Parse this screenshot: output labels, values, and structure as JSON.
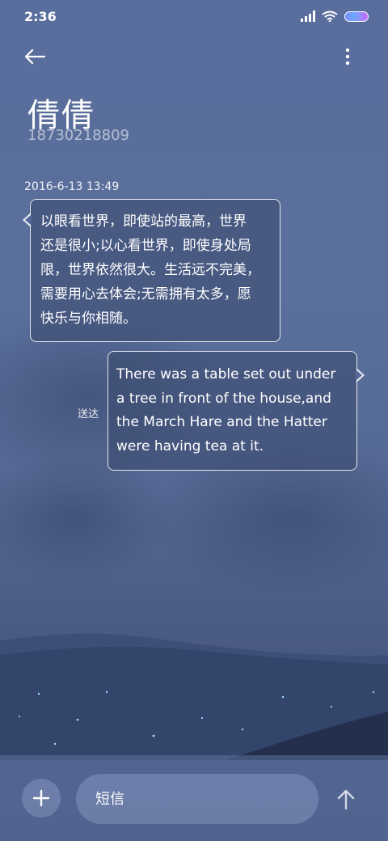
{
  "status_bar": {
    "time": "2:36",
    "icons": [
      "signal-icon",
      "wifi-icon",
      "battery-icon"
    ]
  },
  "toolbar": {
    "back_icon": "arrow-left-icon",
    "more_icon": "more-vertical-icon"
  },
  "contact": {
    "name": "倩倩",
    "number": "18730218809"
  },
  "conversation": {
    "timestamp": "2016-6-13 13:49",
    "messages": [
      {
        "direction": "incoming",
        "lines": [
          "以眼看世界，即使站的最高，世界",
          "还是很小;以心看世界，即使身处局",
          "限，世界依然很大。生活远不完美，",
          "需要用心去体会;无需拥有太多，愿",
          "快乐与你相随。"
        ]
      },
      {
        "direction": "outgoing",
        "lines": [
          "There was a table set out under",
          "a tree in front of the house,and",
          "the March Hare and the Hatter",
          "were having tea at it."
        ],
        "status": "送达"
      }
    ]
  },
  "composer": {
    "placeholder": "短信",
    "add_icon": "plus-icon",
    "send_icon": "arrow-up-icon"
  },
  "colors": {
    "background_top": "#596e9c",
    "background_bottom": "#41527a",
    "bubble_border": "#ffffff",
    "battery_gradient_start": "#7a8cff",
    "battery_gradient_end": "#c56bff"
  }
}
